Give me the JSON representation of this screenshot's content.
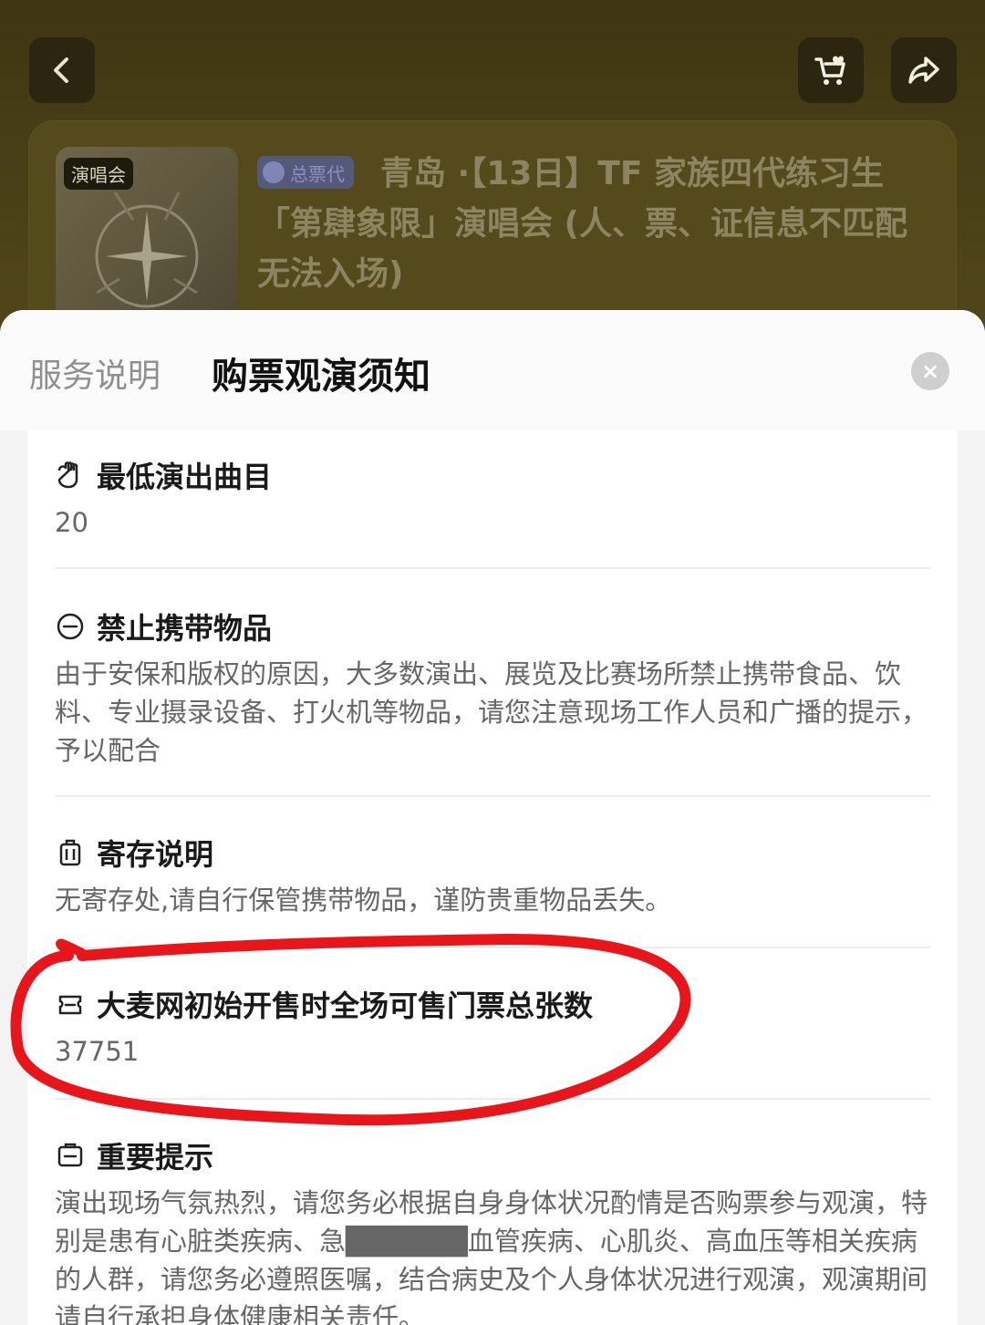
{
  "event": {
    "poster_tag": "演唱会",
    "agent_badge": "总票代",
    "title": "青岛 ·【13日】TF 家族四代练习生「第肆象限」演唱会 (人、票、证信息不匹配无法入场)"
  },
  "sheet": {
    "tabs": [
      {
        "label": "服务说明"
      },
      {
        "label": "购票观演须知"
      }
    ],
    "close_label": "×"
  },
  "sections": [
    {
      "title": "最低演出曲目",
      "icon": "microphone-icon",
      "body": "20"
    },
    {
      "title": "禁止携带物品",
      "icon": "no-entry-icon",
      "body": "由于安保和版权的原因，大多数演出、展览及比赛场所禁止携带食品、饮料、专业摄录设备、打火机等物品，请您注意现场工作人员和广播的提示，予以配合"
    },
    {
      "title": "寄存说明",
      "icon": "luggage-icon",
      "body": "无寄存处,请自行保管携带物品，谨防贵重物品丢失。"
    },
    {
      "title": "大麦网初始开售时全场可售门票总张数",
      "icon": "ticket-icon",
      "body": "37751"
    },
    {
      "title": "重要提示",
      "icon": "notice-icon",
      "body": "演出现场气氛热烈，请您务必根据自身身体状况酌情是否购票参与观演，特别是患有心脏类疾病、急██████血管疾病、心肌炎、高血压等相关疾病的人群，请您务必遵照医嘱，结合病史及个人身体状况进行观演，观演期间请自行承担身体健康相关责任。"
    }
  ],
  "colors": {
    "highlight_circle": "#e8161b",
    "overlay": "#4a3f14"
  }
}
